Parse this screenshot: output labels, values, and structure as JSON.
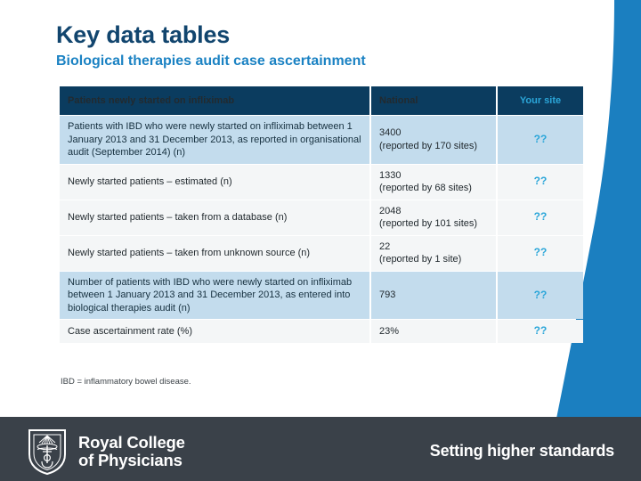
{
  "slide": {
    "title": "Key data tables",
    "subtitle": "Biological therapies audit case ascertainment",
    "footnote": "IBD = inflammatory bowel disease."
  },
  "table": {
    "headers": {
      "label": "Patients newly started on infliximab",
      "national": "National",
      "your_site": "Your site"
    },
    "rows": [
      {
        "label": "Patients with IBD who were newly started on infliximab between 1 January 2013 and 31 December 2013, as reported in organisational audit (September 2014) (n)",
        "national_value": "3400",
        "national_note": "(reported by 170 sites)",
        "your_site": "??",
        "style": "shade",
        "indent": false
      },
      {
        "label": "Newly started patients – estimated (n)",
        "national_value": "1330",
        "national_note": "(reported by 68 sites)",
        "your_site": "??",
        "style": "plain",
        "indent": true
      },
      {
        "label": "Newly started patients – taken from a database (n)",
        "national_value": "2048",
        "national_note": "(reported by 101 sites)",
        "your_site": "??",
        "style": "plain",
        "indent": true
      },
      {
        "label": "Newly started patients – taken from unknown source (n)",
        "national_value": "22",
        "national_note": "(reported by 1 site)",
        "your_site": "??",
        "style": "plain",
        "indent": true
      },
      {
        "label": "Number of patients with IBD who were newly started on infliximab between 1 January 2013 and 31 December 2013, as entered into biological therapies audit (n)",
        "national_value": "793",
        "national_note": "",
        "your_site": "??",
        "style": "shade",
        "indent": false
      },
      {
        "label": "Case ascertainment rate (%)",
        "national_value": "23%",
        "national_note": "",
        "your_site": "??",
        "style": "plain",
        "indent": true
      }
    ]
  },
  "footer": {
    "logo_line1": "Royal College",
    "logo_line2": "of Physicians",
    "tagline": "Setting higher standards"
  },
  "colors": {
    "accent_blue": "#1b7fc0",
    "header_navy": "#0b3c5f",
    "title_navy": "#11456e",
    "subtitle_blue": "#1b82c3",
    "shade_blue": "#c3dced",
    "plain_grey": "#f4f6f7",
    "placeholder_cyan": "#2ba6d9",
    "footer_slate": "#3a4149"
  }
}
